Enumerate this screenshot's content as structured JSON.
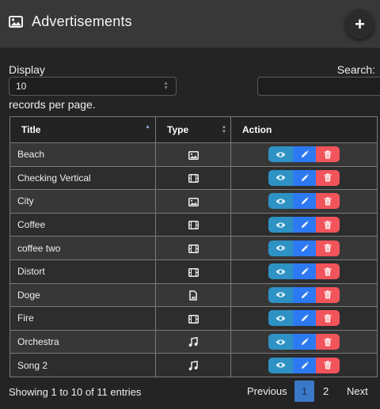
{
  "header": {
    "title": "Advertisements",
    "image_icon": "image-icon",
    "add_icon": "plus-icon",
    "add_label": "+"
  },
  "controls": {
    "display_label": "Display",
    "display_value": "10",
    "records_label": "records per page.",
    "search_label": "Search:",
    "search_value": ""
  },
  "table": {
    "columns": [
      "Title",
      "Type",
      "Action"
    ],
    "sort": {
      "column": "Title",
      "direction": "ascending"
    },
    "rows": [
      {
        "title": "Beach",
        "type_icon": "image-icon"
      },
      {
        "title": "Checking Vertical",
        "type_icon": "film-icon"
      },
      {
        "title": "City",
        "type_icon": "image-icon"
      },
      {
        "title": "Coffee",
        "type_icon": "film-icon"
      },
      {
        "title": "coffee two",
        "type_icon": "film-icon"
      },
      {
        "title": "Distort",
        "type_icon": "film-icon"
      },
      {
        "title": "Doge",
        "type_icon": "image-file-icon"
      },
      {
        "title": "Fire",
        "type_icon": "film-icon"
      },
      {
        "title": "Orchestra",
        "type_icon": "music-icon"
      },
      {
        "title": "Song 2",
        "type_icon": "music-icon"
      }
    ],
    "actions": [
      "eye-icon",
      "pencil-icon",
      "trash-icon"
    ]
  },
  "footer": {
    "info": "Showing 1 to 10 of 11 entries",
    "previous": "Previous",
    "pages": [
      "1",
      "2"
    ],
    "current_page": "1",
    "next": "Next"
  },
  "colors": {
    "background": "#242424",
    "header": "#383838",
    "view": "#2e92c4",
    "edit": "#2d79f2",
    "delete": "#f2545b",
    "active_page": "#3a78c8"
  }
}
